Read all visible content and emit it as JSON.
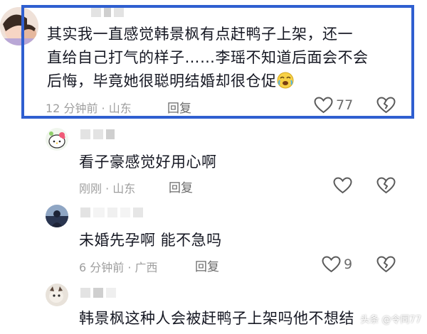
{
  "comments": [
    {
      "text_lines": [
        "其实我一直感觉韩景枫有点赶鸭子上架，还一",
        "直给自己打气的样子……李瑶不知道后面会不会",
        "后悔，毕竟她很聪明结婚却很仓促"
      ],
      "emoji": "crying-laughing-emoji",
      "meta": "12 分钟前 · 山东",
      "reply": "回复",
      "likes": "77",
      "highlighted": true
    },
    {
      "text_lines": [
        "看子豪感觉好用心啊"
      ],
      "meta": "刚刚 · 山东",
      "reply": "回复",
      "likes": ""
    },
    {
      "text_lines": [
        "未婚先孕啊 能不急吗"
      ],
      "meta": "6 分钟前 · 广西",
      "reply": "回复",
      "likes": "9"
    },
    {
      "text_lines": [
        "韩景枫这种人会被赶鸭子上架吗他不想结"
      ],
      "partial_line": "",
      "meta": "",
      "reply": "",
      "likes": ""
    }
  ],
  "watermark": "头条 @令同77",
  "colors": {
    "highlight_border": "#2f5fd0",
    "text": "#161823",
    "meta": "#9e9e9e"
  }
}
